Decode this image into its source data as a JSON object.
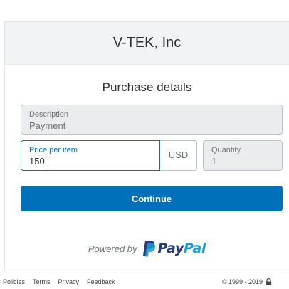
{
  "header": {
    "merchant_name": "V-TEK, Inc"
  },
  "purchase": {
    "title": "Purchase details",
    "description": {
      "label": "Description",
      "value": "Payment"
    },
    "price": {
      "label": "Price per item",
      "value": "150"
    },
    "currency": "USD",
    "quantity": {
      "label": "Quantity",
      "value": "1"
    }
  },
  "actions": {
    "continue_label": "Continue"
  },
  "branding": {
    "powered_by": "Powered by",
    "paypal_pay": "Pay",
    "paypal_pal": "Pal"
  },
  "footer": {
    "links": [
      "Policies",
      "Terms",
      "Privacy",
      "Feedback"
    ],
    "copyright": "© 1999 - 2019"
  },
  "colors": {
    "accent": "#0070ba",
    "paypal_dark": "#253b80",
    "paypal_light": "#179bd7"
  },
  "icons": {
    "lock": "lock-icon",
    "paypal": "paypal-logo-icon"
  }
}
